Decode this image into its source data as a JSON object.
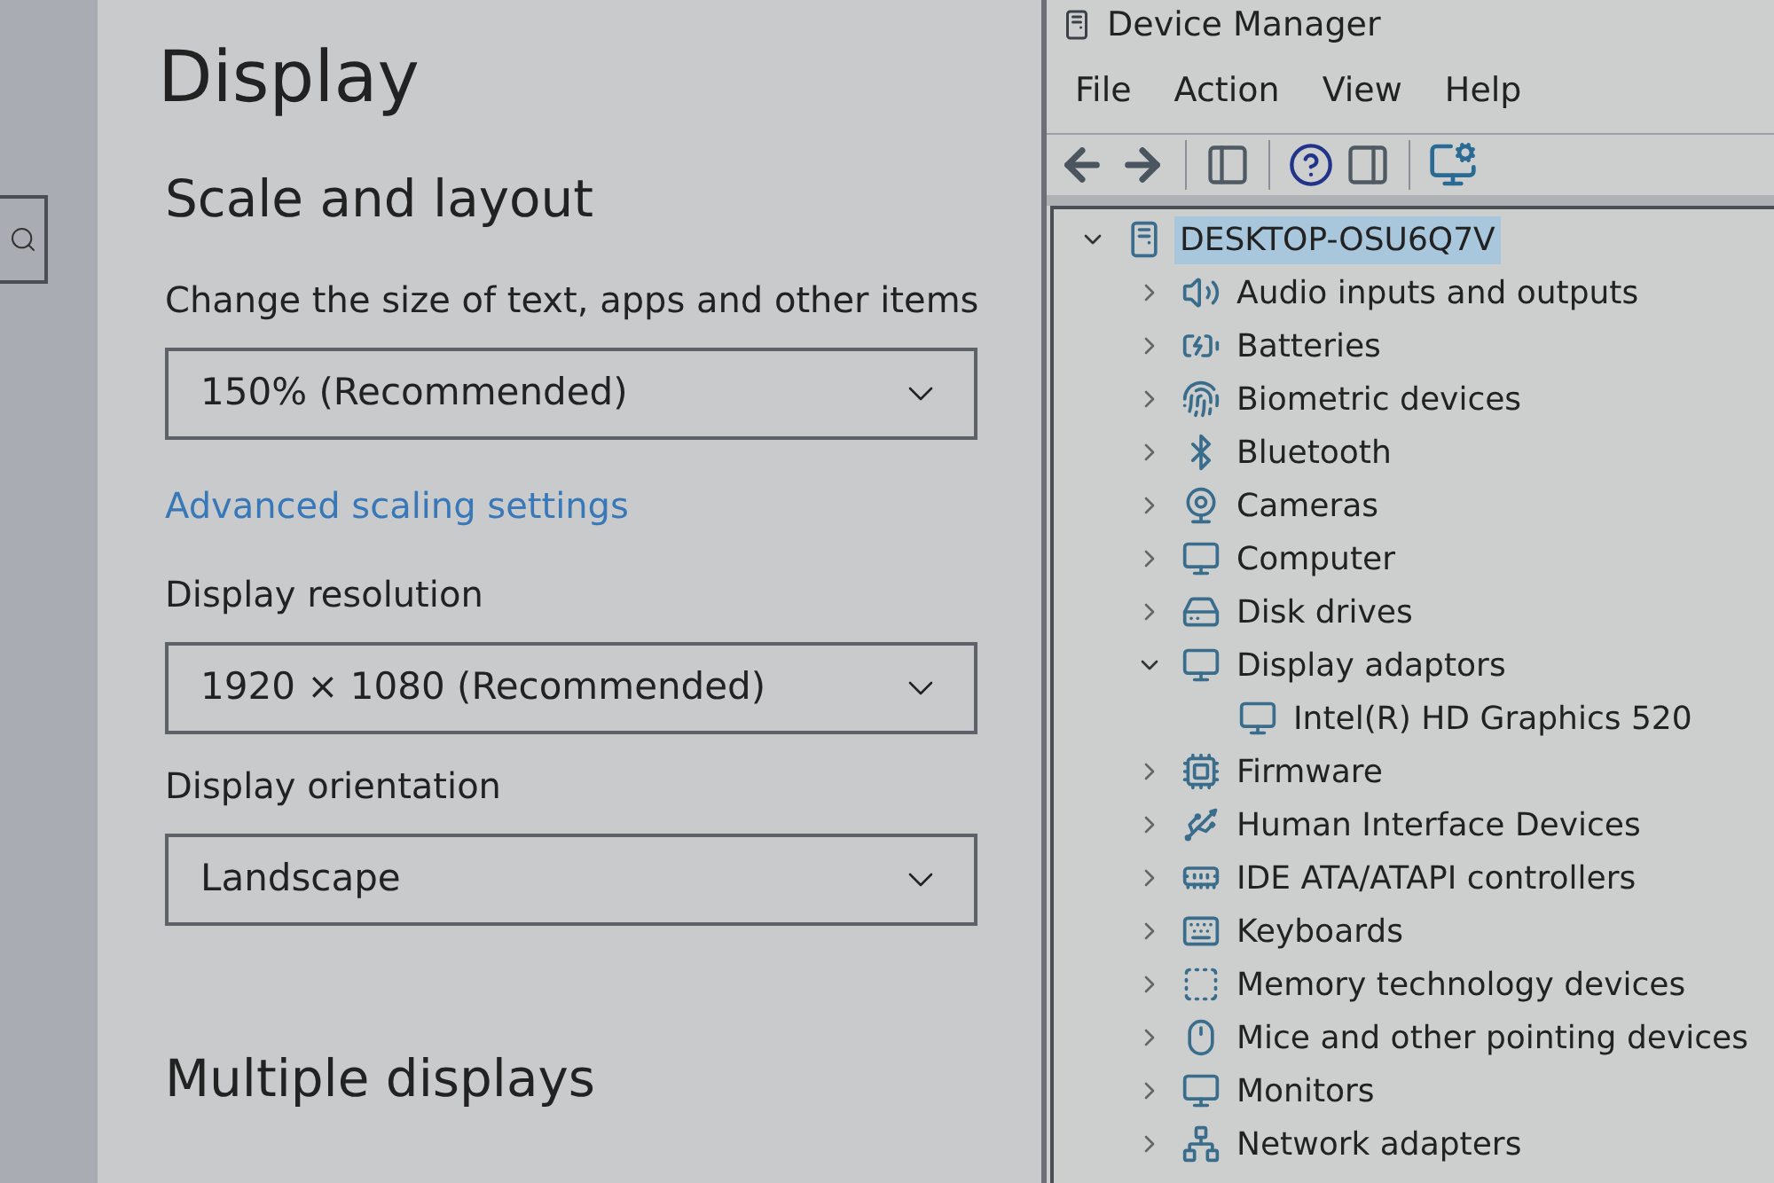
{
  "settings": {
    "title": "Display",
    "section": "Scale and layout",
    "fields": [
      {
        "label": "Change the size of text, apps and other items",
        "value": "150% (Recommended)",
        "link": "Advanced scaling settings"
      },
      {
        "label": "Display resolution",
        "value": "1920 × 1080 (Recommended)"
      },
      {
        "label": "Display orientation",
        "value": "Landscape"
      }
    ],
    "next_section": "Multiple displays"
  },
  "device_manager": {
    "title": "Device Manager",
    "menu": [
      "File",
      "Action",
      "View",
      "Help"
    ],
    "tree": [
      {
        "label": "DESKTOP-OSU6Q7V",
        "expanded": true,
        "selected": true,
        "children": [
          {
            "label": "Audio inputs and outputs",
            "expanded": false,
            "selected": false
          },
          {
            "label": "Batteries",
            "expanded": false,
            "selected": false
          },
          {
            "label": "Biometric devices",
            "expanded": false,
            "selected": false
          },
          {
            "label": "Bluetooth",
            "expanded": false,
            "selected": false
          },
          {
            "label": "Cameras",
            "expanded": false,
            "selected": false
          },
          {
            "label": "Computer",
            "expanded": false,
            "selected": false
          },
          {
            "label": "Disk drives",
            "expanded": false,
            "selected": false
          },
          {
            "label": "Display adaptors",
            "expanded": true,
            "selected": false,
            "children": [
              {
                "label": "Intel(R) HD Graphics 520",
                "selected": false
              }
            ]
          },
          {
            "label": "Firmware",
            "expanded": false,
            "selected": false
          },
          {
            "label": "Human Interface Devices",
            "expanded": false,
            "selected": false
          },
          {
            "label": "IDE ATA/ATAPI controllers",
            "expanded": false,
            "selected": false
          },
          {
            "label": "Keyboards",
            "expanded": false,
            "selected": false
          },
          {
            "label": "Memory technology devices",
            "expanded": false,
            "selected": false
          },
          {
            "label": "Mice and other pointing devices",
            "expanded": false,
            "selected": false
          },
          {
            "label": "Monitors",
            "expanded": false,
            "selected": false
          },
          {
            "label": "Network adapters",
            "expanded": false,
            "selected": false
          }
        ]
      }
    ]
  }
}
